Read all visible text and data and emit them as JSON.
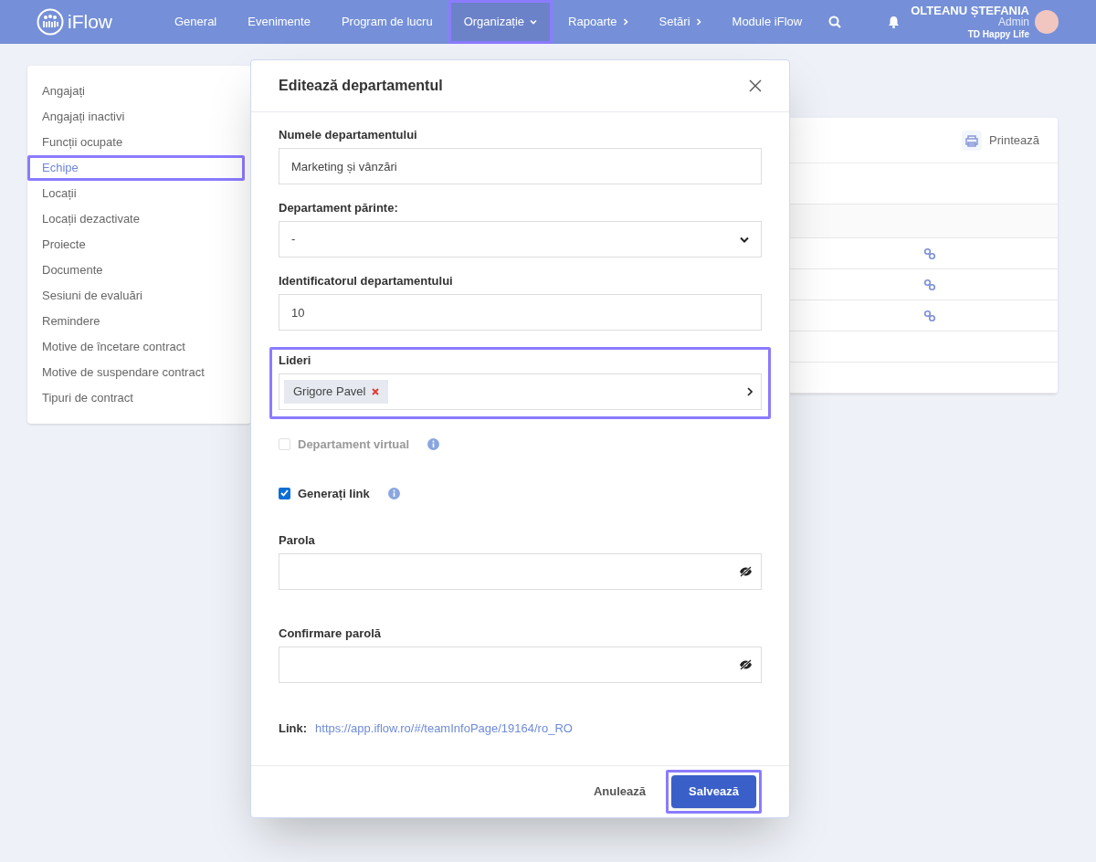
{
  "topbar": {
    "logo": "iFlow",
    "nav": [
      {
        "label": "General",
        "kind": "link",
        "highlighted": false
      },
      {
        "label": "Evenimente",
        "kind": "link",
        "highlighted": false
      },
      {
        "label": "Program de lucru",
        "kind": "link",
        "highlighted": false
      },
      {
        "label": "Organizație",
        "kind": "dropdown",
        "highlighted": true
      },
      {
        "label": "Rapoarte",
        "kind": "submenu",
        "highlighted": false
      },
      {
        "label": "Setări",
        "kind": "submenu",
        "highlighted": false
      },
      {
        "label": "Module iFlow",
        "kind": "link",
        "highlighted": false
      }
    ],
    "user": {
      "name": "OLTEANU ȘTEFANIA",
      "role": "Admin",
      "company": "TD Happy Life"
    }
  },
  "sidebar": {
    "items": [
      {
        "label": "Angajați",
        "selected": false,
        "highlighted": false
      },
      {
        "label": "Angajați inactivi",
        "selected": false,
        "highlighted": false
      },
      {
        "label": "Funcții ocupate",
        "selected": false,
        "highlighted": false
      },
      {
        "label": "Echipe",
        "selected": true,
        "highlighted": true
      },
      {
        "label": "Locații",
        "selected": false,
        "highlighted": false
      },
      {
        "label": "Locații dezactivate",
        "selected": false,
        "highlighted": false
      },
      {
        "label": "Proiecte",
        "selected": false,
        "highlighted": false
      },
      {
        "label": "Documente",
        "selected": false,
        "highlighted": false
      },
      {
        "label": "Sesiuni de evaluări",
        "selected": false,
        "highlighted": false
      },
      {
        "label": "Remindere",
        "selected": false,
        "highlighted": false
      },
      {
        "label": "Motive de încetare contract",
        "selected": false,
        "highlighted": false
      },
      {
        "label": "Motive de suspendare contract",
        "selected": false,
        "highlighted": false
      },
      {
        "label": "Tipuri de contract",
        "selected": false,
        "highlighted": false
      }
    ]
  },
  "background_card": {
    "print_button": "Printează",
    "rows": [
      {
        "kind": "blank"
      },
      {
        "kind": "header"
      },
      {
        "kind": "link"
      },
      {
        "kind": "link"
      },
      {
        "kind": "link"
      },
      {
        "kind": "blank"
      },
      {
        "kind": "blank"
      }
    ]
  },
  "modal": {
    "title": "Editează departamentul",
    "fields": [
      {
        "kind": "text",
        "label": "Numele departamentului",
        "value": "Marketing și vânzări"
      },
      {
        "kind": "select",
        "label": "Departament părinte:",
        "value": "-"
      },
      {
        "kind": "text",
        "label": "Identificatorul departamentului",
        "value": "10"
      },
      {
        "kind": "tags",
        "label": "Lideri",
        "tags": [
          "Grigore Pavel"
        ],
        "highlighted": true
      },
      {
        "kind": "checkbox",
        "label": "Departament virtual",
        "checked": false,
        "disabled": true
      },
      {
        "kind": "checkbox",
        "label": "Generați link",
        "checked": true,
        "disabled": false
      },
      {
        "kind": "password",
        "label": "Parola"
      },
      {
        "kind": "password",
        "label": "Confirmare parolă"
      },
      {
        "kind": "link",
        "label": "Link:",
        "url": "https://app.iflow.ro/#/teamInfoPage/19164/ro_RO"
      }
    ],
    "cancel_button": "Anulează",
    "save_button": {
      "label": "Salvează",
      "highlighted": true
    }
  }
}
